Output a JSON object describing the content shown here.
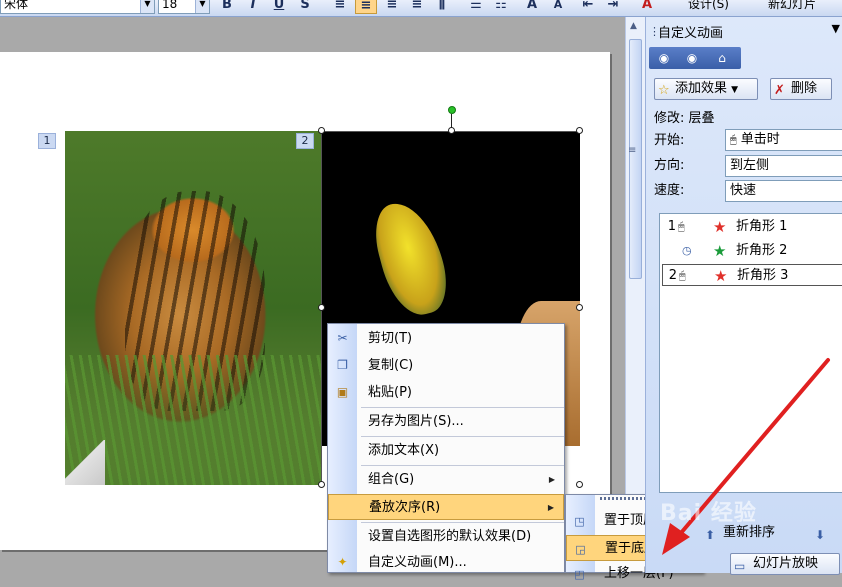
{
  "toolbar": {
    "font_name": "宋体",
    "font_size": "18",
    "bold": "B",
    "italic": "I",
    "underline": "U",
    "shadow": "S",
    "design": "设计(S)",
    "new_slide": "新幻灯片"
  },
  "slide": {
    "badge_1": "1",
    "badge_2": "2"
  },
  "context_menu": {
    "items": [
      {
        "label": "剪切(T)",
        "icon": "scissors-icon"
      },
      {
        "label": "复制(C)",
        "icon": "copy-icon"
      },
      {
        "label": "粘贴(P)",
        "icon": "paste-icon"
      },
      {
        "label": "另存为图片(S)...",
        "icon": ""
      },
      {
        "label": "添加文本(X)",
        "icon": ""
      },
      {
        "label": "组合(G)",
        "icon": ""
      },
      {
        "label": "叠放次序(R)",
        "icon": ""
      },
      {
        "label": "设置自选图形的默认效果(D)",
        "icon": ""
      },
      {
        "label": "自定义动画(M)...",
        "icon": "animation-icon"
      }
    ]
  },
  "sub_menu": {
    "items": [
      {
        "label": "置于顶层(U)"
      },
      {
        "label": "置于底层(K)"
      },
      {
        "label": "上移一层(F)"
      }
    ]
  },
  "task_pane": {
    "title": "自定义动画",
    "add_effect": "添加效果",
    "delete": "删除",
    "modify": "修改: 层叠",
    "start_label": "开始:",
    "start_value": "单击时",
    "direction_label": "方向:",
    "direction_value": "到左侧",
    "speed_label": "速度:",
    "speed_value": "快速",
    "animations": [
      {
        "num": "1",
        "name": "折角形 1",
        "color": "#e0302a"
      },
      {
        "num": "",
        "name": "折角形 2",
        "color": "#1a9b3a"
      },
      {
        "num": "2",
        "name": "折角形 3",
        "color": "#e0302a"
      }
    ],
    "reorder": "重新排序",
    "slideshow": "幻灯片放映"
  },
  "watermark": "Bai 经验"
}
